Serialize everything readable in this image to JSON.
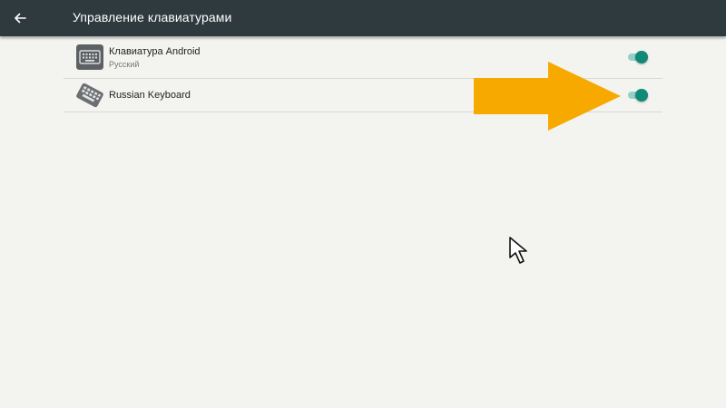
{
  "header": {
    "title": "Управление клавиатурами",
    "back_icon": "arrow-left-icon"
  },
  "keyboards": [
    {
      "name": "Клавиатура Android",
      "subtitle": "Русский",
      "icon": "keyboard-icon",
      "enabled": true
    },
    {
      "name": "Russian Keyboard",
      "subtitle": "",
      "icon": "keyboard-tilted-icon",
      "enabled": true
    }
  ],
  "colors": {
    "appbar": "#2f3a3f",
    "background": "#f3f4ef",
    "toggle_thumb": "#0f8a76",
    "toggle_track": "#93d1c8",
    "annotation_arrow": "#f7a900"
  }
}
